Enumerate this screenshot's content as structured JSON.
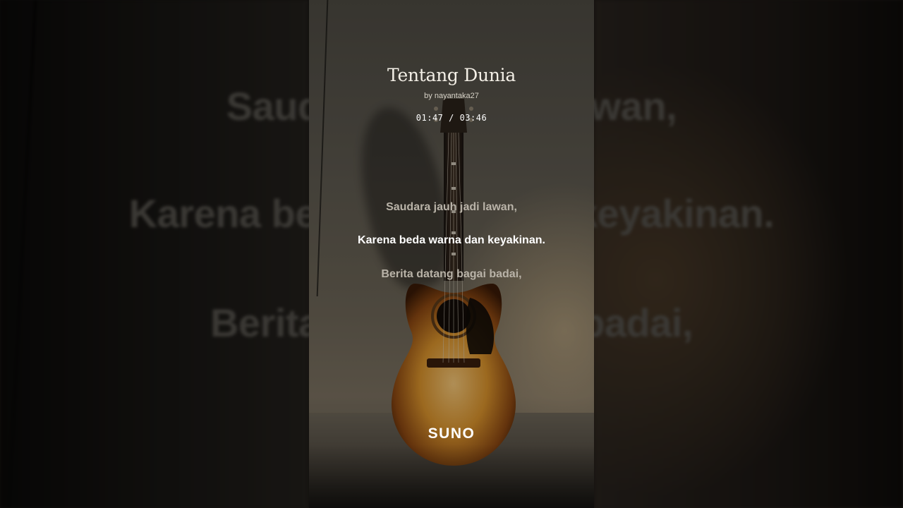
{
  "song": {
    "title": "Tentang Dunia",
    "byline": "by nayantaka27",
    "time": "01:47 / 03:46"
  },
  "lyrics": {
    "previous": "Saudara jauh jadi lawan,",
    "current": "Karena beda warna dan keyakinan.",
    "next": "Berita datang bagai badai,"
  },
  "background_lyrics": {
    "line1": "Saudara jauh jadi lawan,",
    "line2": "Karena beda warna dan keyakinan.",
    "line3": "Berita datang bagai badai,"
  },
  "brand": {
    "logo": "SUNO"
  },
  "colors": {
    "active_lyric": "#ffffff",
    "dim_lyric": "#b9b3a8",
    "guitar_body": "#d8922c"
  }
}
